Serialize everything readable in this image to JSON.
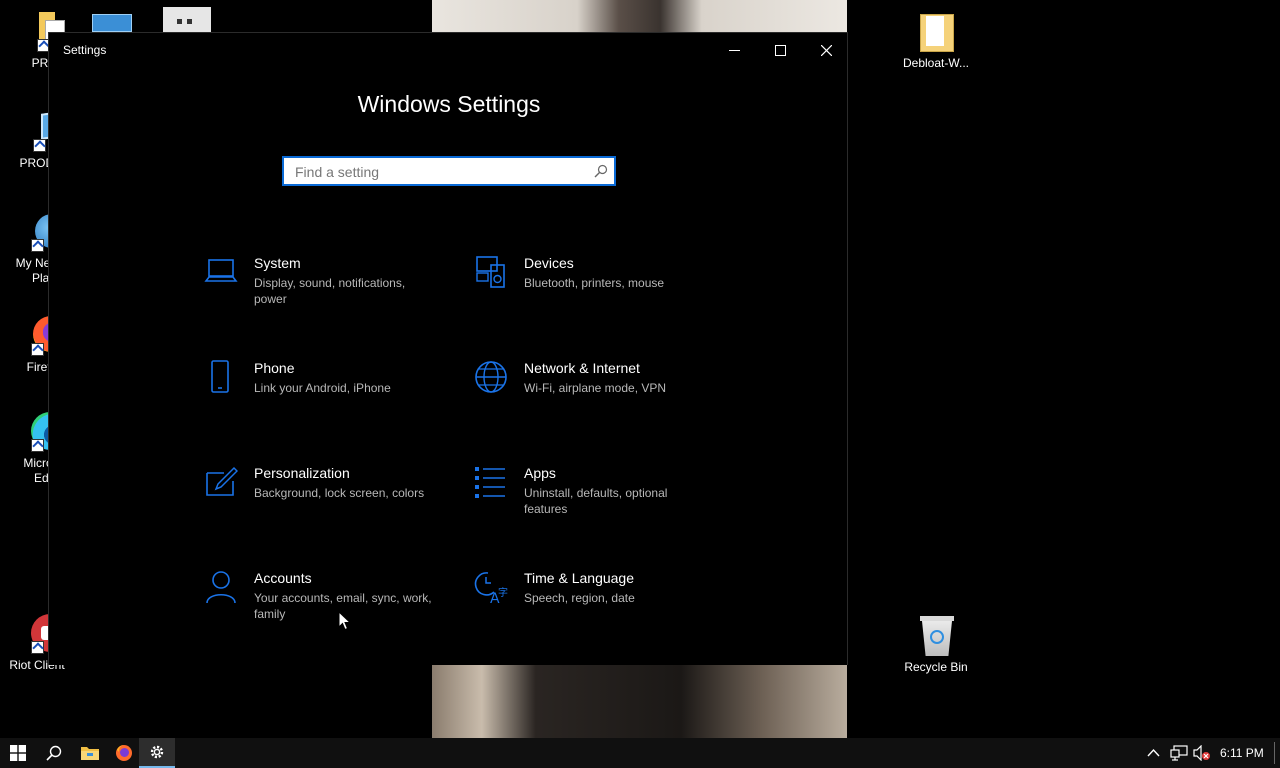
{
  "desktop": {
    "icons_left": [
      {
        "label": "PROD"
      },
      {
        "label": "PROD's"
      },
      {
        "label_line1": "My Netw",
        "label_line2": "Place"
      },
      {
        "label": "Firefo"
      },
      {
        "label_line1": "Micros",
        "label_line2": "Edge"
      },
      {
        "label": "Riot Client"
      }
    ],
    "icons_right": [
      {
        "label": "Debloat-W..."
      },
      {
        "label": "Recycle Bin"
      }
    ]
  },
  "window": {
    "title": "Settings",
    "heading": "Windows Settings",
    "search": {
      "placeholder": "Find a setting",
      "value": ""
    },
    "tiles": [
      {
        "title": "System",
        "desc": "Display, sound, notifications, power",
        "icon": "laptop-icon"
      },
      {
        "title": "Devices",
        "desc": "Bluetooth, printers, mouse",
        "icon": "devices-icon"
      },
      {
        "title": "Phone",
        "desc": "Link your Android, iPhone",
        "icon": "phone-icon"
      },
      {
        "title": "Network & Internet",
        "desc": "Wi-Fi, airplane mode, VPN",
        "icon": "globe-icon"
      },
      {
        "title": "Personalization",
        "desc": "Background, lock screen, colors",
        "icon": "paint-icon"
      },
      {
        "title": "Apps",
        "desc": "Uninstall, defaults, optional features",
        "icon": "apps-list-icon"
      },
      {
        "title": "Accounts",
        "desc": "Your accounts, email, sync, work, family",
        "icon": "person-icon"
      },
      {
        "title": "Time & Language",
        "desc": "Speech, region, date",
        "icon": "time-language-icon"
      }
    ]
  },
  "taskbar": {
    "clock": "6:11 PM"
  },
  "colors": {
    "accent": "#0a6ad6",
    "icon_blue": "#1a73e8",
    "desc_gray": "#b8b8b8"
  }
}
